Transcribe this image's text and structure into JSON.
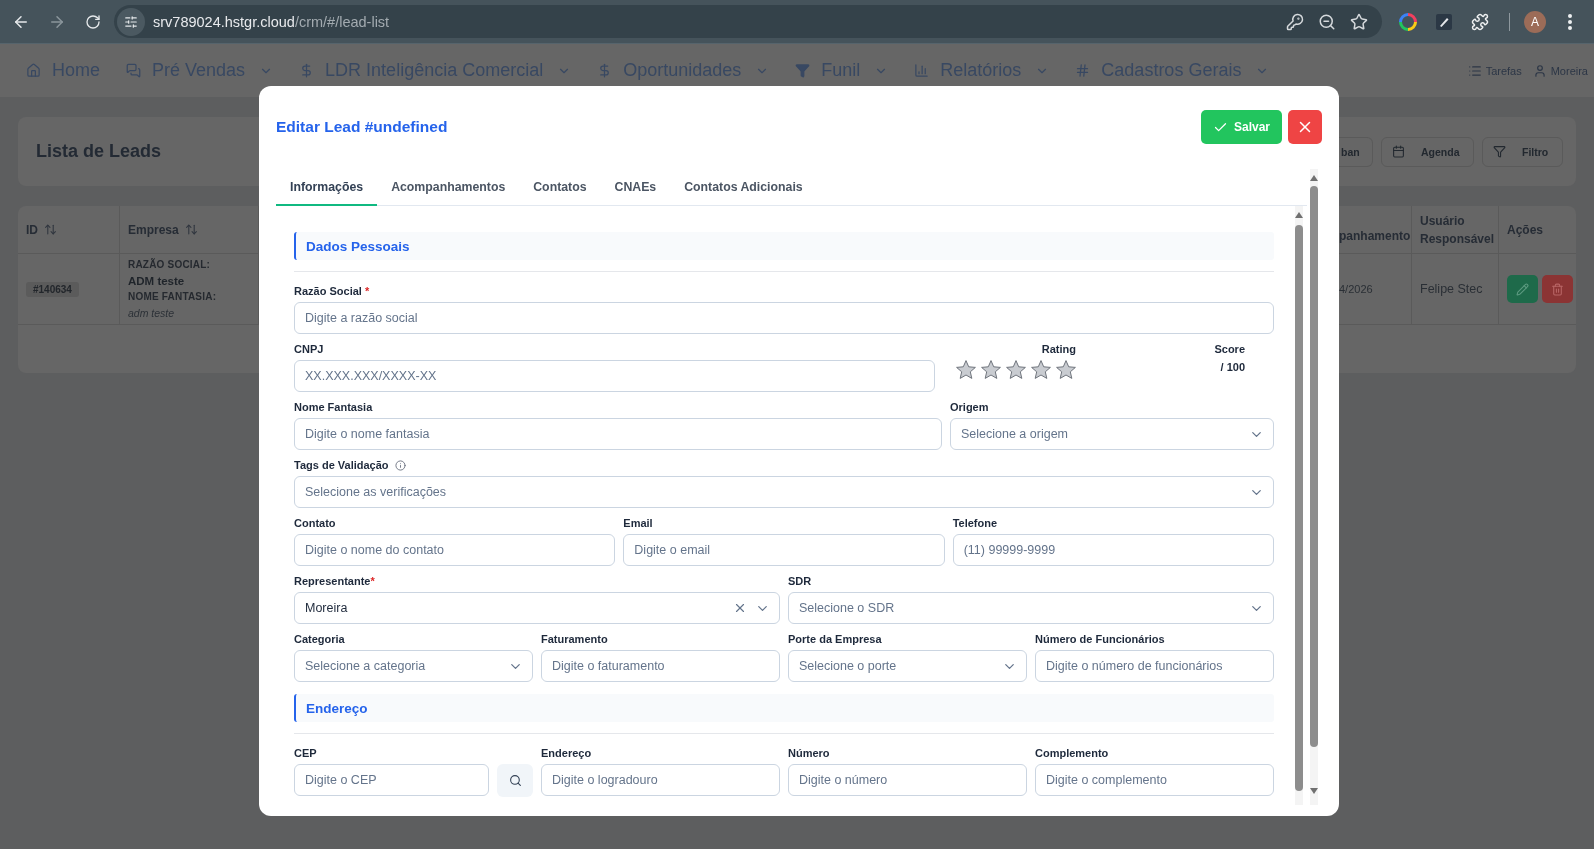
{
  "browser": {
    "forward_disabled": true,
    "url_host": "srv789024.hstgr.cloud",
    "url_path": "/crm/#/lead-list",
    "profile_initial": "A"
  },
  "nav": {
    "items": [
      {
        "label": "Home",
        "dropdown": false
      },
      {
        "label": "Pré Vendas",
        "dropdown": true
      },
      {
        "label": "LDR Inteligência Comercial",
        "dropdown": true
      },
      {
        "label": "Oportunidades",
        "dropdown": true
      },
      {
        "label": "Funil",
        "dropdown": true
      },
      {
        "label": "Relatórios",
        "dropdown": true
      },
      {
        "label": "Cadastros Gerais",
        "dropdown": true
      }
    ],
    "right": [
      {
        "label": "Tarefas"
      },
      {
        "label": "Moreira"
      }
    ]
  },
  "page": {
    "title": "Lista de Leads",
    "header_buttons": [
      {
        "label": "ban"
      },
      {
        "label": "Agenda"
      },
      {
        "label": "Filtro"
      }
    ],
    "table": {
      "columns": [
        {
          "label": "ID",
          "sortable": true
        },
        {
          "label": "Empresa",
          "sortable": true
        },
        {
          "label": "panhamento",
          "sortable": false
        },
        {
          "label": "Usuário Responsável",
          "sortable": false
        },
        {
          "label": "Ações",
          "sortable": false
        }
      ],
      "rows": [
        {
          "id": "#140634",
          "razao_label": "RAZÃO SOCIAL:",
          "razao": "ADM teste",
          "fantasia_label": "NOME FANTASIA:",
          "fantasia": "adm teste",
          "acompanhamento": "4/2026",
          "usuario": "Felipe Stec",
          "actions": [
            {
              "kind": "edit"
            },
            {
              "kind": "delete"
            }
          ]
        }
      ]
    }
  },
  "modal": {
    "title": "Editar Lead #undefined",
    "save_label": "Salvar",
    "tabs": [
      {
        "label": "Informações",
        "selected": true
      },
      {
        "label": "Acompanhamentos",
        "selected": false
      },
      {
        "label": "Contatos",
        "selected": false
      },
      {
        "label": "CNAEs",
        "selected": false
      },
      {
        "label": "Contatos Adicionais",
        "selected": false
      }
    ],
    "sections": [
      {
        "title": "Dados Pessoais",
        "rows": [
          [
            {
              "kind": "text",
              "label": "Razão Social",
              "required_mark": " *",
              "placeholder": "Digite a razão social"
            }
          ],
          [
            {
              "kind": "text",
              "label": "CNPJ",
              "placeholder": "XX.XXX.XXX/XXXX-XX"
            },
            {
              "kind": "rating",
              "label": "Rating",
              "stars": 0
            },
            {
              "kind": "score",
              "label": "Score",
              "suffix": "/ 100"
            }
          ],
          [
            {
              "kind": "text",
              "label": "Nome Fantasia",
              "placeholder": "Digite o nome fantasia"
            },
            {
              "kind": "select",
              "label": "Origem",
              "placeholder": "Selecione a origem"
            }
          ],
          [
            {
              "kind": "select",
              "label": "Tags de Validação",
              "info": true,
              "placeholder": "Selecione as verificações"
            }
          ],
          [
            {
              "kind": "text",
              "label": "Contato",
              "placeholder": "Digite o nome do contato"
            },
            {
              "kind": "text",
              "label": "Email",
              "placeholder": "Digite o email"
            },
            {
              "kind": "text",
              "label": "Telefone",
              "placeholder": "(11) 99999-9999"
            }
          ],
          [
            {
              "kind": "select",
              "label": "Representante",
              "required_mark": "*",
              "value": "Moreira"
            },
            {
              "kind": "select",
              "label": "SDR",
              "placeholder": "Selecione o SDR"
            }
          ],
          [
            {
              "kind": "select",
              "label": "Categoria",
              "placeholder": "Selecione a categoria"
            },
            {
              "kind": "text",
              "label": "Faturamento",
              "placeholder": "Digite o faturamento"
            },
            {
              "kind": "select",
              "label": "Porte da Empresa",
              "placeholder": "Selecione o porte"
            },
            {
              "kind": "text",
              "label": "Número de Funcionários",
              "placeholder": "Digite o número de funcionários"
            }
          ]
        ]
      },
      {
        "title": "Endereço",
        "rows": [
          [
            {
              "kind": "search",
              "label": "CEP",
              "placeholder": "Digite o CEP"
            },
            {
              "kind": "text",
              "label": "Endereço",
              "placeholder": "Digite o logradouro"
            },
            {
              "kind": "text",
              "label": "Número",
              "placeholder": "Digite o número"
            },
            {
              "kind": "text",
              "label": "Complemento",
              "placeholder": "Digite o complemento"
            }
          ]
        ]
      }
    ]
  }
}
